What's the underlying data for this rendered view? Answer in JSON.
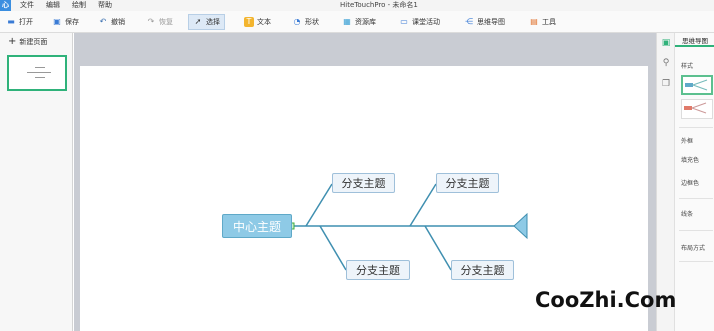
{
  "app": {
    "logo": "心",
    "title": "HiteTouchPro - 未命名1"
  },
  "menu": [
    "文件",
    "编辑",
    "绘制",
    "帮助"
  ],
  "toolbar": {
    "open": "打开",
    "save": "保存",
    "undo": "撤销",
    "redo": "恢复",
    "select": "选择",
    "text": "文本",
    "shape": "形状",
    "resources": "资源库",
    "classroom": "课堂活动",
    "mindmap": "思维导图",
    "tools": "工具"
  },
  "left_panel": {
    "new_page": "新建页面"
  },
  "right_panel": {
    "tab": "思维导图",
    "style_label": "样式",
    "props": [
      "外框",
      "填充色",
      "边框色",
      "线条",
      "布局方式"
    ]
  },
  "mindmap": {
    "center": "中心主题",
    "branches": [
      "分支主题",
      "分支主题",
      "分支主题",
      "分支主题"
    ],
    "colors": {
      "center_fill": "#8ecae6",
      "node_fill": "#eef4fa",
      "line": "#3f8fb0",
      "accent": "#2fb27a"
    }
  },
  "watermark": "CooZhi.Com"
}
